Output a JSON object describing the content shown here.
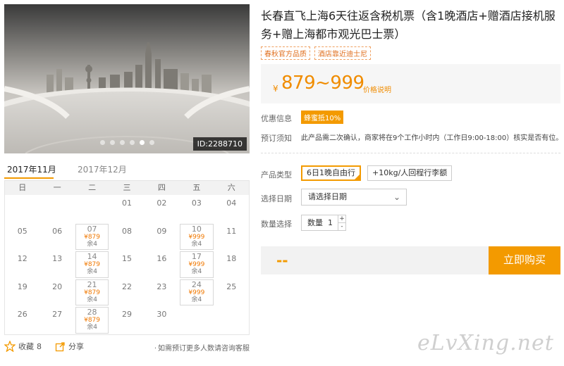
{
  "gallery": {
    "image_id": "ID:2288710",
    "dots": 6,
    "active_dot": 4
  },
  "calendar": {
    "tabs": [
      "2017年11月",
      "2017年12月"
    ],
    "weekdays": [
      "日",
      "一",
      "二",
      "三",
      "四",
      "五",
      "六"
    ],
    "rows": [
      [
        null,
        null,
        null,
        {
          "d": "01"
        },
        {
          "d": "02"
        },
        {
          "d": "03"
        },
        {
          "d": "04"
        }
      ],
      [
        {
          "d": "05"
        },
        {
          "d": "06"
        },
        {
          "d": "07",
          "price": "¥879",
          "stock": "余4"
        },
        {
          "d": "08"
        },
        {
          "d": "09"
        },
        {
          "d": "10",
          "price": "¥999",
          "stock": "余4"
        },
        {
          "d": "11"
        }
      ],
      [
        {
          "d": "12"
        },
        {
          "d": "13"
        },
        {
          "d": "14",
          "price": "¥879",
          "stock": "余4"
        },
        {
          "d": "15"
        },
        {
          "d": "16"
        },
        {
          "d": "17",
          "price": "¥999",
          "stock": "余4"
        },
        {
          "d": "18"
        }
      ],
      [
        {
          "d": "19"
        },
        {
          "d": "20"
        },
        {
          "d": "21",
          "price": "¥879",
          "stock": "余4"
        },
        {
          "d": "22"
        },
        {
          "d": "23"
        },
        {
          "d": "24",
          "price": "¥999",
          "stock": "余4"
        },
        {
          "d": "25"
        }
      ],
      [
        {
          "d": "26"
        },
        {
          "d": "27"
        },
        {
          "d": "28",
          "price": "¥879",
          "stock": "余4"
        },
        {
          "d": "29"
        },
        {
          "d": "30"
        },
        null,
        null
      ]
    ]
  },
  "footer": {
    "favorite_label": "收藏",
    "favorite_count": "8",
    "share_label": "分享",
    "consult_text": "如需预订更多人数请咨询客服"
  },
  "product": {
    "title": "长春直飞上海6天往返含税机票（含1晚酒店+赠酒店接机服务+赠上海都市观光巴士票）",
    "badges": [
      "春秋官方品质",
      "酒店靠近迪士尼"
    ],
    "price_currency": "¥",
    "price_range": "879~999",
    "price_explain": "价格说明",
    "promo_label": "优惠信息",
    "promo_tag": "蜂蜜抵10%",
    "notice_label": "预订须知",
    "notice_text": "此产品需二次确认，商家将在9个工作小时内（工作日9:00-18:00）核实是否有位。",
    "type_label": "产品类型",
    "type_options": [
      "6日1晚自由行",
      "+10kg/人回程行李额"
    ],
    "date_label": "选择日期",
    "date_placeholder": "请选择日期",
    "qty_label": "数量选择",
    "qty_prefix": "数量",
    "qty_value": "1",
    "buy_summary": "--",
    "buy_button": "立即购买"
  },
  "watermark": "eLvXing.net",
  "colors": {
    "accent": "#f39a00",
    "price": "#f08c00"
  }
}
